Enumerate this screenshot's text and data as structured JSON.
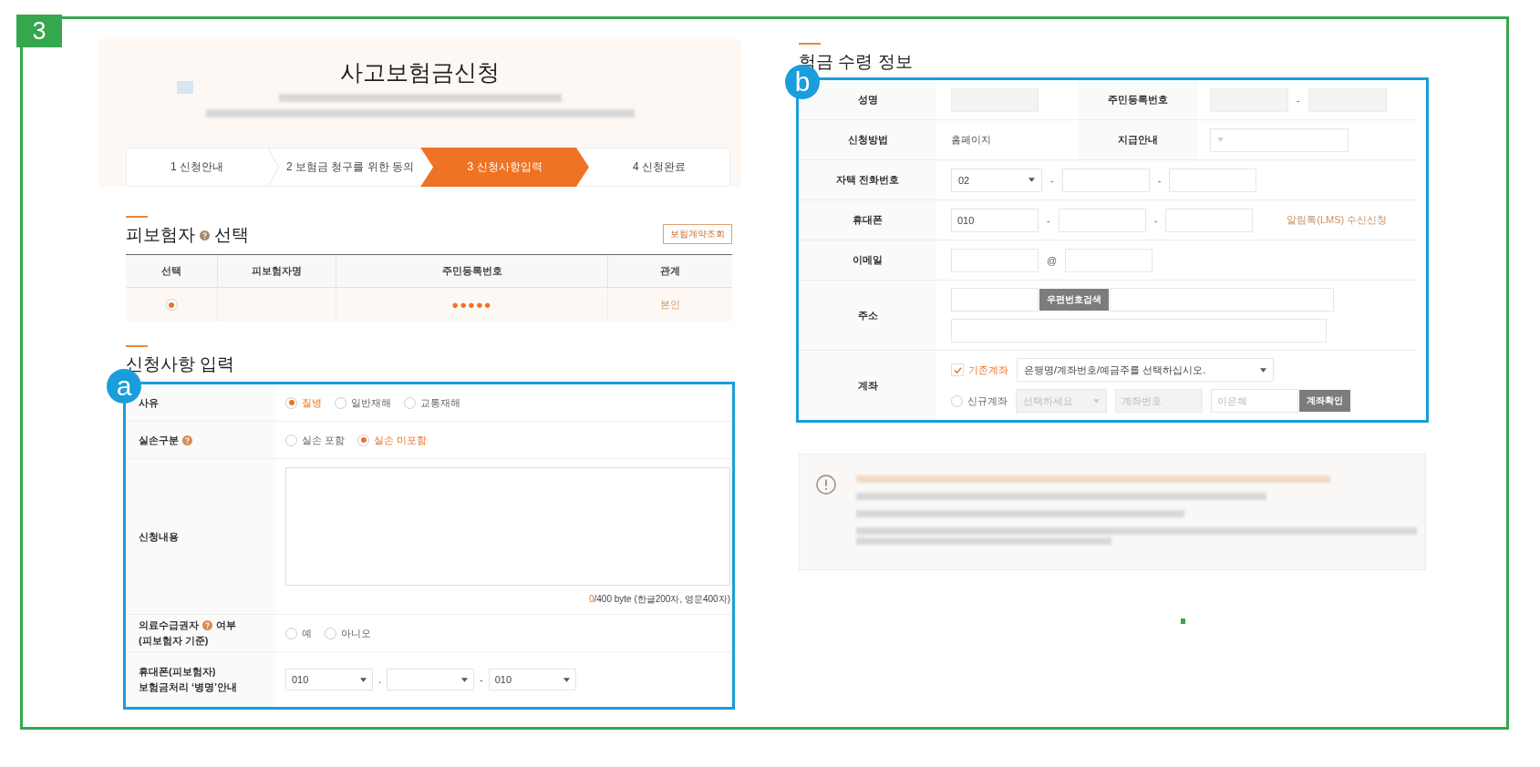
{
  "step_badge": "3",
  "header": {
    "title": "사고보험금신청",
    "steps": [
      {
        "label": "1 신청안내",
        "selected": false
      },
      {
        "label": "2 보험금 청구를 위한 동의",
        "selected": false
      },
      {
        "label": "3 신청사항입력",
        "selected": true
      },
      {
        "label": "4 신청완료",
        "selected": false
      }
    ]
  },
  "insured": {
    "title_before": "피보험자",
    "title_after": "선택",
    "lookup_button": "보험계약조회",
    "columns": [
      "선택",
      "피보험자명",
      "주민등록번호",
      "관계"
    ],
    "rows": [
      {
        "selected": true,
        "rrn": "●●●●●",
        "relation": "본인"
      }
    ]
  },
  "request": {
    "title": "신청사항 입력",
    "badge": "a",
    "rows": [
      {
        "kind": "radio",
        "label": "사유",
        "help": false,
        "options": [
          {
            "label": "질병",
            "selected": true
          },
          {
            "label": "일반재해",
            "selected": false
          },
          {
            "label": "교통재해",
            "selected": false
          }
        ]
      },
      {
        "kind": "radio",
        "label": "실손구분",
        "help": true,
        "options": [
          {
            "label": "실손 포함",
            "selected": false
          },
          {
            "label": "실손 미포함",
            "selected": true
          }
        ]
      },
      {
        "kind": "textarea",
        "label": "신청내용",
        "help": false,
        "count": "0",
        "limit": "/400 byte (한글200자, 영문400자)"
      },
      {
        "kind": "radio",
        "label": "의료수급권자",
        "help": true,
        "label_after": "여부",
        "label_line2": "(피보험자 기준)",
        "options": [
          {
            "label": "예",
            "selected": false
          },
          {
            "label": "아니오",
            "selected": false
          }
        ]
      },
      {
        "kind": "selects",
        "label": "휴대폰(피보험자)",
        "help": false,
        "label_line2": "보험금처리 ‘병명’안내",
        "parts": [
          {
            "kind": "select",
            "value": "010"
          },
          {
            "kind": "sep",
            "text": "."
          },
          {
            "kind": "select"
          },
          {
            "kind": "sep",
            "text": "-"
          },
          {
            "kind": "select",
            "value": "010"
          }
        ]
      }
    ]
  },
  "receipt": {
    "title": "험금 수령 정보",
    "badge": "b",
    "rows": [
      {
        "label": "성명",
        "lines": [
          [
            {
              "kind": "input",
              "disabled": true
            }
          ]
        ],
        "label2": "주민등록번호",
        "lines2": [
          [
            {
              "kind": "input",
              "disabled": true
            },
            {
              "kind": "sep",
              "text": "-"
            },
            {
              "kind": "input",
              "disabled": true
            }
          ]
        ]
      },
      {
        "label": "신청방법",
        "lines": [
          [
            {
              "kind": "text",
              "text": "홈페이지"
            }
          ]
        ],
        "label2": "지급안내",
        "lines2": [
          [
            {
              "kind": "select"
            }
          ]
        ]
      },
      {
        "label": "자택 전화번호",
        "lines": [
          [
            {
              "kind": "select",
              "value": "02"
            },
            {
              "kind": "sep",
              "text": "-"
            },
            {
              "kind": "input"
            },
            {
              "kind": "sep",
              "text": "-"
            },
            {
              "kind": "input"
            }
          ]
        ]
      },
      {
        "label": "휴대폰",
        "lines": [
          [
            {
              "kind": "input",
              "value": "010"
            },
            {
              "kind": "sep",
              "text": "-"
            },
            {
              "kind": "input"
            },
            {
              "kind": "sep",
              "text": "-"
            },
            {
              "kind": "input"
            },
            {
              "kind": "note",
              "text": "알림톡(LMS) 수신신청"
            }
          ]
        ]
      },
      {
        "label": "이메일",
        "lines": [
          [
            {
              "kind": "input"
            },
            {
              "kind": "sep",
              "text": "@"
            },
            {
              "kind": "input"
            }
          ]
        ]
      },
      {
        "label": "주소",
        "lines": [
          [
            {
              "kind": "input"
            },
            {
              "kind": "button",
              "text": "우편번호검색"
            },
            {
              "kind": "long_input"
            }
          ],
          [
            {
              "kind": "full_input"
            }
          ]
        ]
      },
      {
        "label": "계좌",
        "lines": [
          [
            {
              "kind": "checkbox",
              "text": "기존계좌",
              "checked": true
            },
            {
              "kind": "long_select",
              "value": "은행명/계좌번호/예금주를 선택하십시오."
            }
          ],
          [
            {
              "kind": "radio",
              "text": "신규계좌",
              "selected": false
            },
            {
              "kind": "select",
              "placeholder": "선택하세요",
              "disabled": true
            },
            {
              "kind": "input",
              "placeholder": "계좌번호",
              "disabled": true
            },
            {
              "kind": "input",
              "placeholder": "이은혜"
            },
            {
              "kind": "button",
              "text": "계좌확인"
            }
          ]
        ]
      }
    ]
  }
}
